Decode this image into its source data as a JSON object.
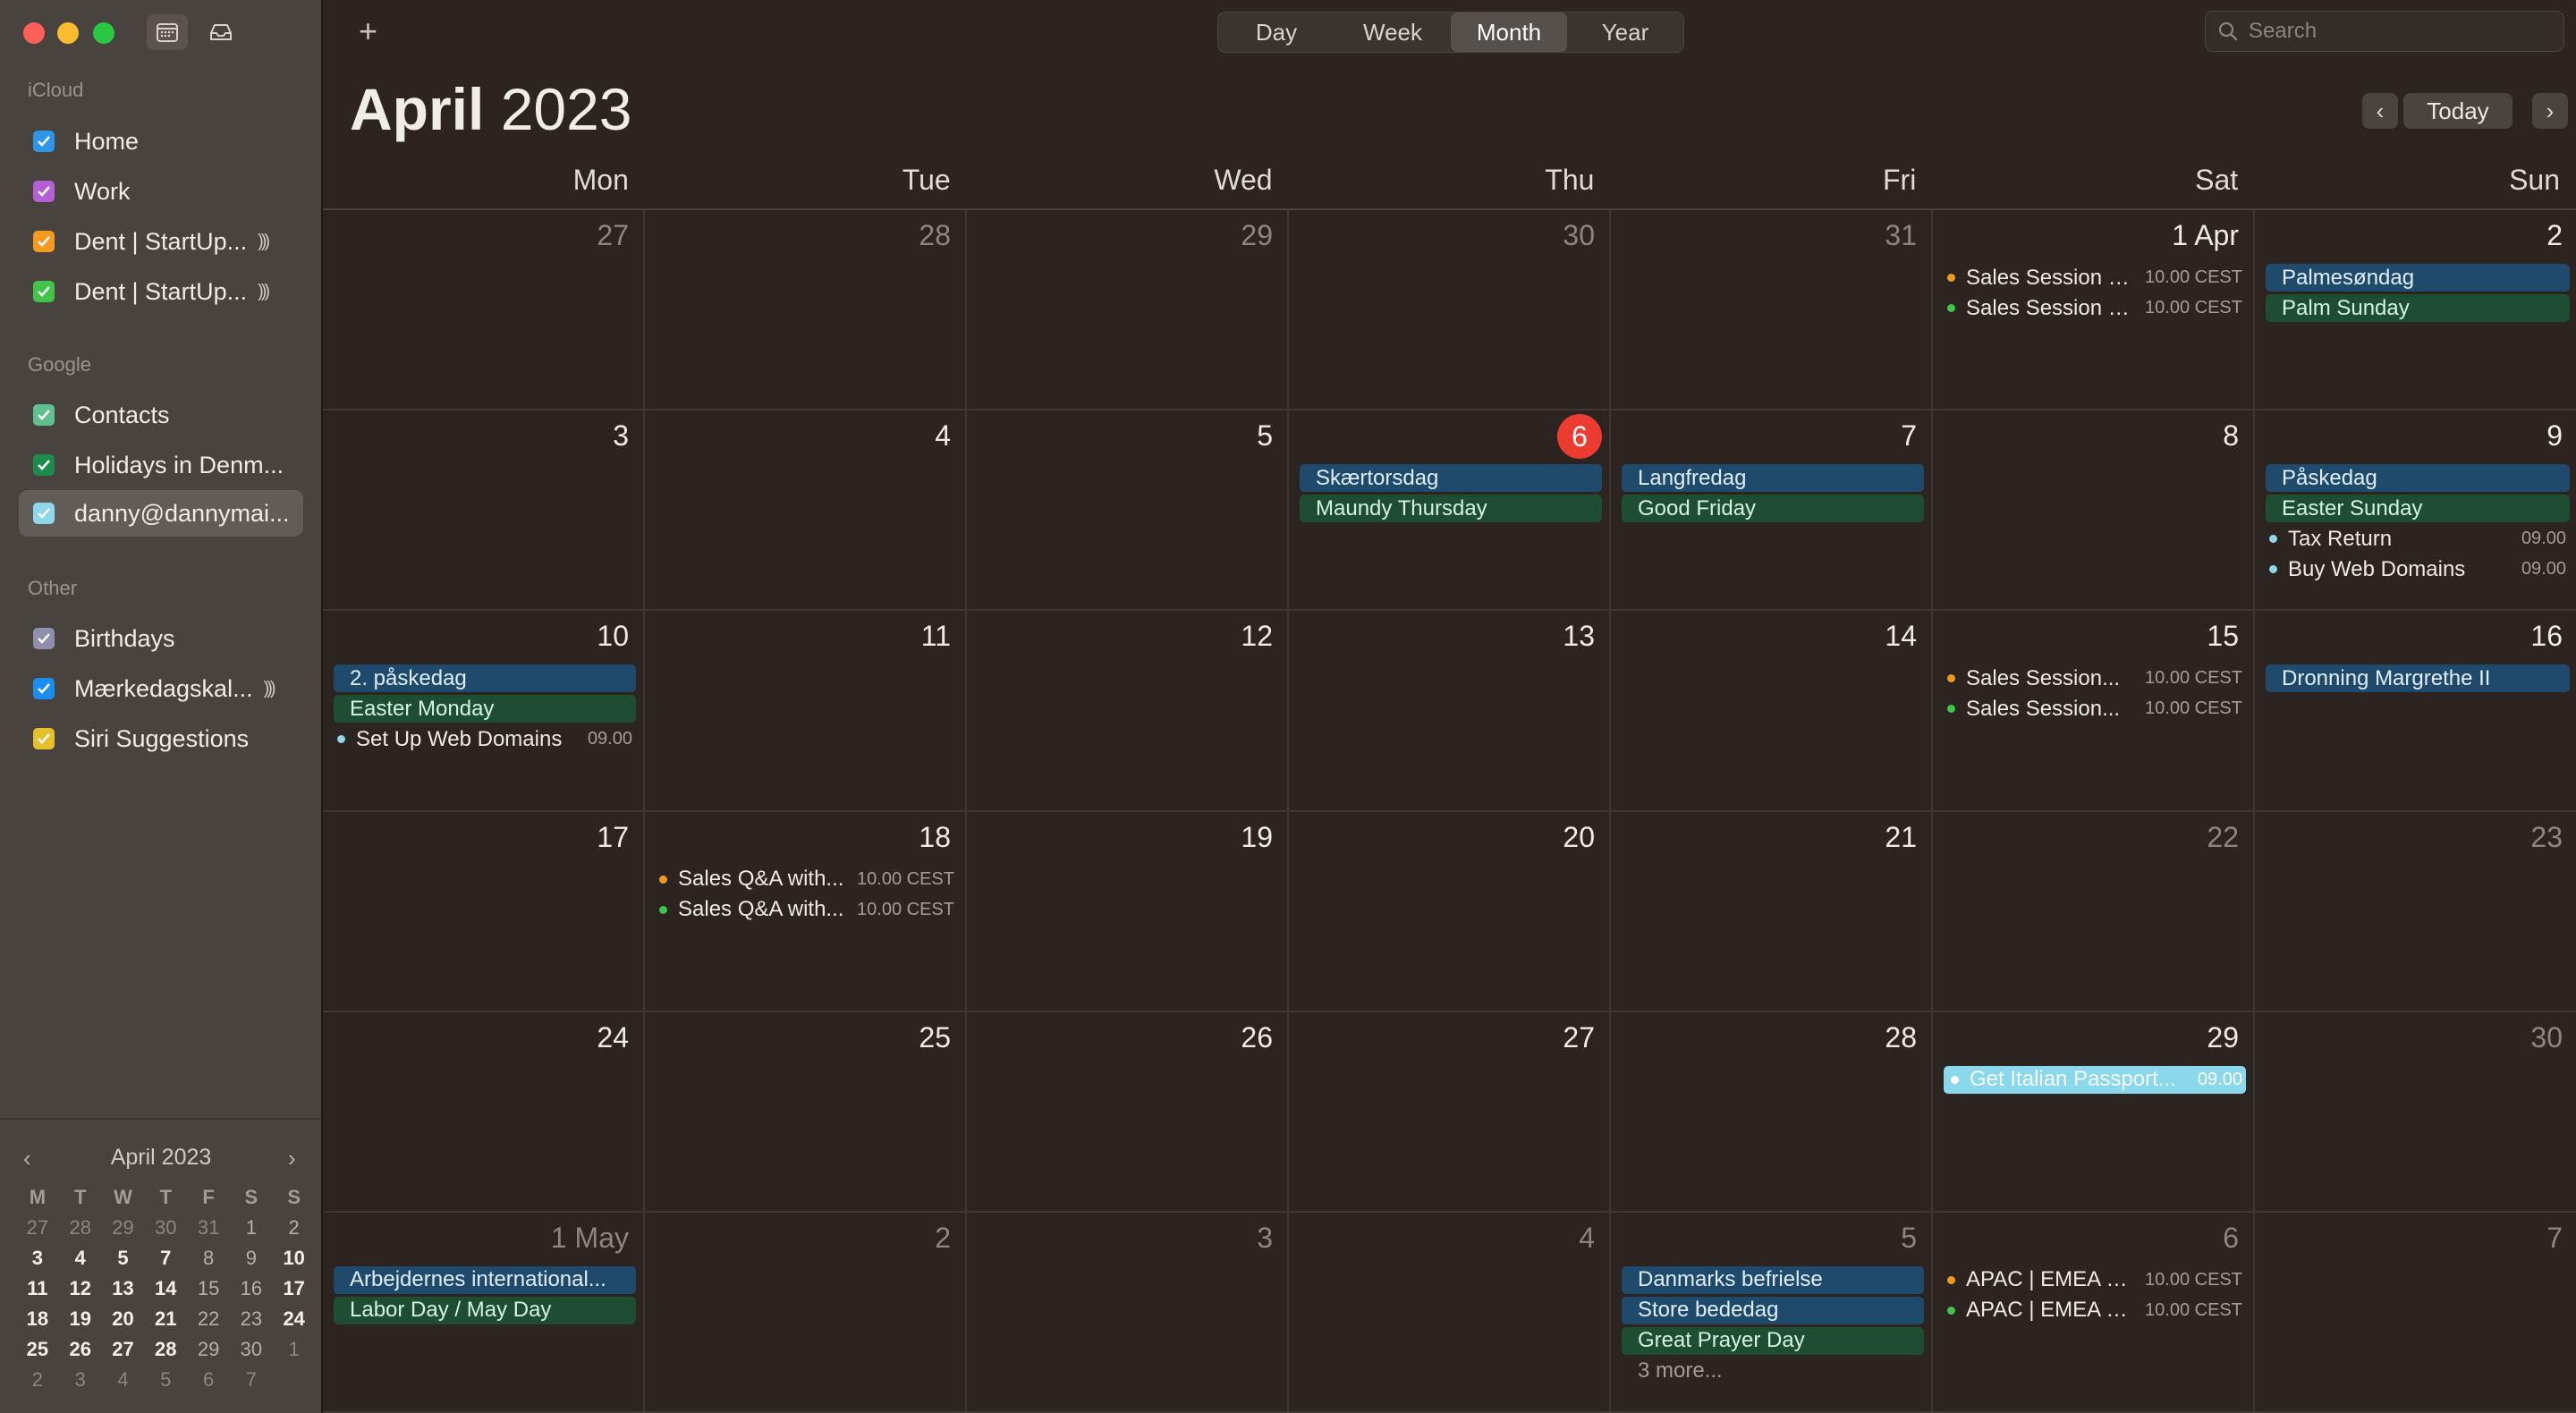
{
  "sidebar": {
    "sections": [
      {
        "title": "iCloud",
        "items": [
          {
            "label": "Home",
            "color": "#2f95e8",
            "broadcast": false
          },
          {
            "label": "Work",
            "color": "#b55fd6",
            "broadcast": false
          },
          {
            "label": "Dent | StartUp...",
            "color": "#f39a1f",
            "broadcast": true
          },
          {
            "label": "Dent | StartUp...",
            "color": "#41c447",
            "broadcast": true
          }
        ]
      },
      {
        "title": "Google",
        "items": [
          {
            "label": "Contacts",
            "color": "#5fbf8f",
            "broadcast": false
          },
          {
            "label": "Holidays in Denm...",
            "color": "#1e8a4b",
            "broadcast": false
          },
          {
            "label": "danny@dannymai...",
            "color": "#8fd7ea",
            "broadcast": false,
            "selected": true
          }
        ]
      },
      {
        "title": "Other",
        "items": [
          {
            "label": "Birthdays",
            "color": "#8f8fad",
            "broadcast": false
          },
          {
            "label": "Mærkedagskal...",
            "color": "#1a8df0",
            "broadcast": true
          },
          {
            "label": "Siri Suggestions",
            "color": "#e6c02c",
            "broadcast": false
          }
        ]
      }
    ],
    "mini_calendar": {
      "title": "April 2023",
      "weekday_headers": [
        "M",
        "T",
        "W",
        "T",
        "F",
        "S",
        "S"
      ],
      "weeks": [
        [
          "27",
          "28",
          "29",
          "30",
          "31",
          "1",
          "2"
        ],
        [
          "3",
          "4",
          "5",
          "6",
          "7",
          "8",
          "9"
        ],
        [
          "10",
          "11",
          "12",
          "13",
          "14",
          "15",
          "16"
        ],
        [
          "17",
          "18",
          "19",
          "20",
          "21",
          "22",
          "23"
        ],
        [
          "24",
          "25",
          "26",
          "27",
          "28",
          "29",
          "30"
        ],
        [
          "1",
          "2",
          "3",
          "4",
          "5",
          "6",
          "7"
        ]
      ],
      "today": "6"
    }
  },
  "toolbar": {
    "views": [
      "Day",
      "Week",
      "Month",
      "Year"
    ],
    "active_view": "Month",
    "search_placeholder": "Search",
    "today_label": "Today"
  },
  "header": {
    "month": "April",
    "year": "2023"
  },
  "weekdays": [
    "Mon",
    "Tue",
    "Wed",
    "Thu",
    "Fri",
    "Sat",
    "Sun"
  ],
  "month_grid": [
    [
      {
        "label": "27",
        "other": true,
        "events": []
      },
      {
        "label": "28",
        "other": true,
        "events": []
      },
      {
        "label": "29",
        "other": true,
        "events": []
      },
      {
        "label": "30",
        "other": true,
        "events": []
      },
      {
        "label": "31",
        "other": true,
        "events": []
      },
      {
        "label": "1 Apr",
        "events": [
          {
            "title": "Sales Session 1...",
            "time": "10.00 CEST",
            "kind": "timed",
            "color": "#f39a1f"
          },
          {
            "title": "Sales Session 1...",
            "time": "10.00 CEST",
            "kind": "timed",
            "color": "#41c447"
          }
        ]
      },
      {
        "label": "2",
        "events": [
          {
            "title": "Palmesøndag",
            "kind": "blue"
          },
          {
            "title": "Palm Sunday",
            "kind": "green"
          }
        ]
      }
    ],
    [
      {
        "label": "3",
        "events": []
      },
      {
        "label": "4",
        "events": []
      },
      {
        "label": "5",
        "events": []
      },
      {
        "label": "6",
        "today": true,
        "events": [
          {
            "title": "Skærtorsdag",
            "kind": "blue"
          },
          {
            "title": "Maundy Thursday",
            "kind": "green"
          }
        ]
      },
      {
        "label": "7",
        "events": [
          {
            "title": "Langfredag",
            "kind": "blue"
          },
          {
            "title": "Good Friday",
            "kind": "green"
          }
        ]
      },
      {
        "label": "8",
        "events": []
      },
      {
        "label": "9",
        "events": [
          {
            "title": "Påskedag",
            "kind": "blue"
          },
          {
            "title": "Easter Sunday",
            "kind": "green"
          },
          {
            "title": "Tax Return",
            "time": "09.00",
            "kind": "timed",
            "color": "#8fd7ea"
          },
          {
            "title": "Buy Web Domains",
            "time": "09.00",
            "kind": "timed",
            "color": "#8fd7ea"
          }
        ]
      }
    ],
    [
      {
        "label": "10",
        "events": [
          {
            "title": "2. påskedag",
            "kind": "blue"
          },
          {
            "title": "Easter Monday",
            "kind": "green"
          },
          {
            "title": "Set Up Web Domains",
            "time": "09.00",
            "kind": "timed",
            "color": "#8fd7ea"
          }
        ]
      },
      {
        "label": "11",
        "events": []
      },
      {
        "label": "12",
        "events": []
      },
      {
        "label": "13",
        "events": []
      },
      {
        "label": "14",
        "events": []
      },
      {
        "label": "15",
        "events": [
          {
            "title": "Sales Session...",
            "time": "10.00 CEST",
            "kind": "timed",
            "color": "#f39a1f"
          },
          {
            "title": "Sales Session...",
            "time": "10.00 CEST",
            "kind": "timed",
            "color": "#41c447"
          }
        ]
      },
      {
        "label": "16",
        "events": [
          {
            "title": "Dronning Margrethe II",
            "kind": "blue"
          }
        ]
      }
    ],
    [
      {
        "label": "17",
        "events": []
      },
      {
        "label": "18",
        "events": [
          {
            "title": "Sales Q&A with...",
            "time": "10.00 CEST",
            "kind": "timed",
            "color": "#f39a1f"
          },
          {
            "title": "Sales Q&A with...",
            "time": "10.00 CEST",
            "kind": "timed",
            "color": "#41c447"
          }
        ]
      },
      {
        "label": "19",
        "events": []
      },
      {
        "label": "20",
        "events": []
      },
      {
        "label": "21",
        "events": []
      },
      {
        "label": "22",
        "weekend": true,
        "events": []
      },
      {
        "label": "23",
        "weekend": true,
        "events": []
      }
    ],
    [
      {
        "label": "24",
        "events": []
      },
      {
        "label": "25",
        "events": []
      },
      {
        "label": "26",
        "events": []
      },
      {
        "label": "27",
        "events": []
      },
      {
        "label": "28",
        "events": []
      },
      {
        "label": "29",
        "events": [
          {
            "title": "Get Italian Passport...",
            "time": "09.00",
            "kind": "cyan",
            "color": "#ffffff"
          }
        ]
      },
      {
        "label": "30",
        "weekend": true,
        "events": []
      }
    ],
    [
      {
        "label": "1 May",
        "other": true,
        "events": [
          {
            "title": "Arbejdernes international...",
            "kind": "blue"
          },
          {
            "title": "Labor Day / May Day",
            "kind": "green"
          }
        ]
      },
      {
        "label": "2",
        "other": true,
        "events": []
      },
      {
        "label": "3",
        "other": true,
        "events": []
      },
      {
        "label": "4",
        "other": true,
        "events": []
      },
      {
        "label": "5",
        "other": true,
        "events": [
          {
            "title": "Danmarks befrielse",
            "kind": "blue"
          },
          {
            "title": "Store bededag",
            "kind": "blue"
          },
          {
            "title": "Great Prayer Day",
            "kind": "green"
          }
        ],
        "more": "3 more..."
      },
      {
        "label": "6",
        "other": true,
        "events": [
          {
            "title": "APAC | EMEA C...",
            "time": "10.00 CEST",
            "kind": "timed",
            "color": "#f39a1f"
          },
          {
            "title": "APAC | EMEA C...",
            "time": "10.00 CEST",
            "kind": "timed",
            "color": "#41c447"
          }
        ]
      },
      {
        "label": "7",
        "other": true,
        "events": []
      }
    ]
  ]
}
